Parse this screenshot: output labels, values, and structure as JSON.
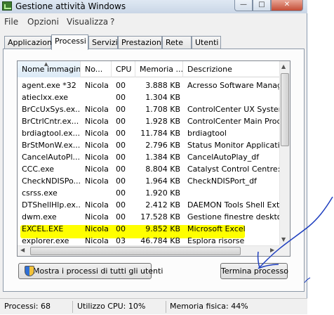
{
  "window": {
    "title": "Gestione attività Windows",
    "icon": "task-manager-icon",
    "controls": {
      "minimize": "—",
      "maximize": "□",
      "close": "✕"
    }
  },
  "menu": [
    "File",
    "Opzioni",
    "Visualizza",
    "?"
  ],
  "tabs": [
    {
      "label": "Applicazioni",
      "active": false
    },
    {
      "label": "Processi",
      "active": true
    },
    {
      "label": "Servizi",
      "active": false
    },
    {
      "label": "Prestazioni",
      "active": false
    },
    {
      "label": "Rete",
      "active": false
    },
    {
      "label": "Utenti",
      "active": false
    }
  ],
  "table": {
    "columns": [
      "Nome immagine",
      "No...",
      "CPU",
      "Memoria ...",
      "Descrizione"
    ],
    "sorted_column": "Nome immagine",
    "rows": [
      [
        "agent.exe *32",
        "Nicola",
        "00",
        "3.888 KB",
        "Acresso Software Manager"
      ],
      [
        "atieclxx.exe",
        "",
        "00",
        "1.304 KB",
        ""
      ],
      [
        "BrCcUxSys.ex...",
        "Nicola",
        "00",
        "1.708 KB",
        "ControlCenter UX System"
      ],
      [
        "BrCtrlCntr.ex...",
        "Nicola",
        "00",
        "1.928 KB",
        "ControlCenter Main Proces"
      ],
      [
        "brdiagtool.ex...",
        "Nicola",
        "00",
        "11.784 KB",
        "brdiagtool"
      ],
      [
        "BrStMonW.ex...",
        "Nicola",
        "00",
        "2.796 KB",
        "Status Monitor Application"
      ],
      [
        "CancelAutoPl...",
        "Nicola",
        "00",
        "1.384 KB",
        "CancelAutoPlay_df"
      ],
      [
        "CCC.exe",
        "Nicola",
        "00",
        "8.804 KB",
        "Catalyst Control Centre: H"
      ],
      [
        "CheckNDISPo...",
        "Nicola",
        "00",
        "1.964 KB",
        "CheckNDISPort_df"
      ],
      [
        "csrss.exe",
        "",
        "00",
        "1.920 KB",
        ""
      ],
      [
        "DTShellHlp.ex...",
        "Nicola",
        "00",
        "2.412 KB",
        "DAEMON Tools Shell Extens"
      ],
      [
        "dwm.exe",
        "Nicola",
        "00",
        "17.528 KB",
        "Gestione finestre desktop"
      ],
      [
        "EXCEL.EXE",
        "Nicola",
        "00",
        "9.852 KB",
        "Microsoft Excel"
      ],
      [
        "explorer.exe",
        "Nicola",
        "03",
        "46.784 KB",
        "Esplora risorse"
      ]
    ],
    "highlighted_row": "EXCEL.EXE",
    "highlight_color": "#ffff00"
  },
  "buttons": {
    "show_all": "Mostra i processi di tutti gli utenti",
    "show_all_icon": "uac-shield-icon",
    "end_process": "Termina processo"
  },
  "status": {
    "processes": "Processi: 68",
    "cpu": "Utilizzo CPU: 10%",
    "memory": "Memoria fisica: 44%"
  },
  "annotation_color": "#1f3fbf"
}
